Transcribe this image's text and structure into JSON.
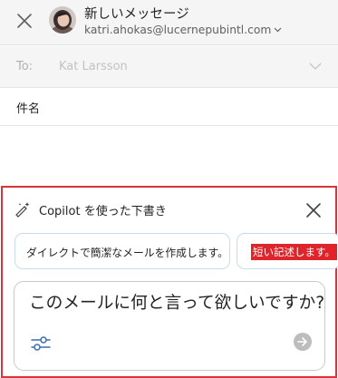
{
  "header": {
    "title": "新しいメッセージ",
    "account": "katri.ahokas@lucernepubintl.com"
  },
  "fields": {
    "to_label": "To:",
    "to_value": "Kat Larsson",
    "subject_label": "件名"
  },
  "copilot": {
    "header_title": "Copilot を使った下書き",
    "suggestions": [
      "ダイレクトで簡潔なメールを作成します。",
      "短い記述します。"
    ],
    "prompt_placeholder": "このメールに何と言って欲しいですか?"
  },
  "colors": {
    "accent_highlight": "#d9343a",
    "chip_border": "#c7dcef"
  },
  "icons": {
    "close": "close-icon",
    "avatar": "avatar",
    "account_menu": "chevron-down-icon",
    "to_expand": "chevron-down-icon",
    "copilot": "copilot-pen-sparkle-icon",
    "panel_close": "close-icon",
    "settings": "sliders-icon",
    "send": "send-arrow-icon"
  }
}
